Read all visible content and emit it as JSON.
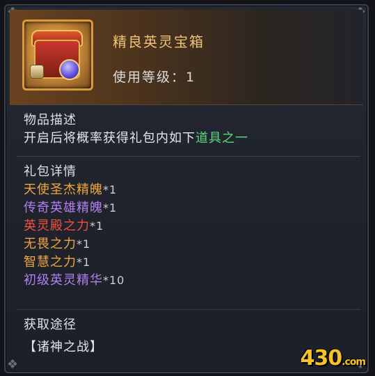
{
  "item": {
    "name": "精良英灵宝箱",
    "level_text": "使用等级：1"
  },
  "description": {
    "heading": "物品描述",
    "text_prefix": "开启后将概率获得礼包内如下",
    "text_highlight": "道具之一",
    "highlight_color": "#5fd67a"
  },
  "contents": {
    "heading": "礼包详情",
    "items": [
      {
        "name": "天使圣杰精魄",
        "qty": "*1",
        "color": "#f0a63a"
      },
      {
        "name": "传奇英雄精魄",
        "qty": "*1",
        "color": "#b07ff0"
      },
      {
        "name": "英灵殿之力",
        "qty": "*1",
        "color": "#f0523a"
      },
      {
        "name": "无畏之力",
        "qty": "*1",
        "color": "#f0a63a"
      },
      {
        "name": "智慧之力",
        "qty": "*1",
        "color": "#f0a63a"
      },
      {
        "name": "初级英灵精华",
        "qty": "*10",
        "color": "#b07ff0"
      }
    ]
  },
  "source": {
    "heading": "获取途径",
    "text": "【诸神之战】"
  },
  "watermark": {
    "text": "430",
    "suffix": ".com"
  }
}
